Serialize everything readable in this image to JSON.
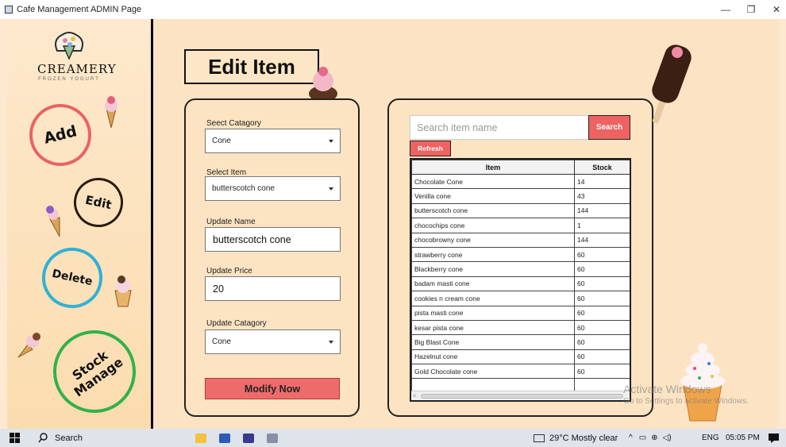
{
  "window": {
    "title": "Cafe Management ADMIN Page",
    "minimize": "—",
    "maximize": "❐",
    "close": "✕"
  },
  "sidebar": {
    "logo_text": "CREAMERY",
    "logo_sub": "FROZEN YOGURT",
    "add_label": "Add",
    "edit_label": "Edit",
    "delete_label": "Delete",
    "stock_label_1": "Stock",
    "stock_label_2": "Manage"
  },
  "edit_form": {
    "page_title": "Edit Item",
    "category_label": "Seect Catagory",
    "category_value": "Cone",
    "item_label": "Select Item",
    "item_value": "butterscotch cone",
    "name_label": "Update Name",
    "name_value": "butterscotch cone",
    "price_label": "Update Price",
    "price_value": "20",
    "update_category_label": "Update Catagory",
    "update_category_value": "Cone",
    "modify_button": "Modify Now"
  },
  "item_list": {
    "search_placeholder": "Search item name",
    "search_button": "Search",
    "refresh_button": "Refresh",
    "columns": [
      "Item",
      "Stock"
    ],
    "rows": [
      [
        "Chocolate Cone",
        "14"
      ],
      [
        "Venilla cone",
        "43"
      ],
      [
        "butterscotch cone",
        "144"
      ],
      [
        "chocochips cone",
        "1"
      ],
      [
        "chocobrowny cone",
        "144"
      ],
      [
        "strawberry cone",
        "60"
      ],
      [
        "Blackberry cone",
        "60"
      ],
      [
        "badam masti cone",
        "60"
      ],
      [
        "cookies n cream cone",
        "60"
      ],
      [
        "pista masti cone",
        "60"
      ],
      [
        "kesar pista cone",
        "60"
      ],
      [
        "Big Blast Cone",
        "60"
      ],
      [
        "Hazelnut cone",
        "60"
      ],
      [
        "Gold Chocolate cone",
        "60"
      ],
      [
        "",
        ""
      ]
    ]
  },
  "watermark": {
    "line1": "Activate Windows",
    "line2": "Go to Settings to activate Windows."
  },
  "taskbar": {
    "search_label": "Search",
    "weather": "29°C  Mostly clear",
    "language": "ENG",
    "time": "05:05 PM"
  },
  "colors": {
    "accent_red": "#ee6262",
    "add_ring": "#ea6262",
    "delete_ring": "#2fb2d6",
    "stock_ring": "#30b24a",
    "background": "#fbe3c4"
  }
}
